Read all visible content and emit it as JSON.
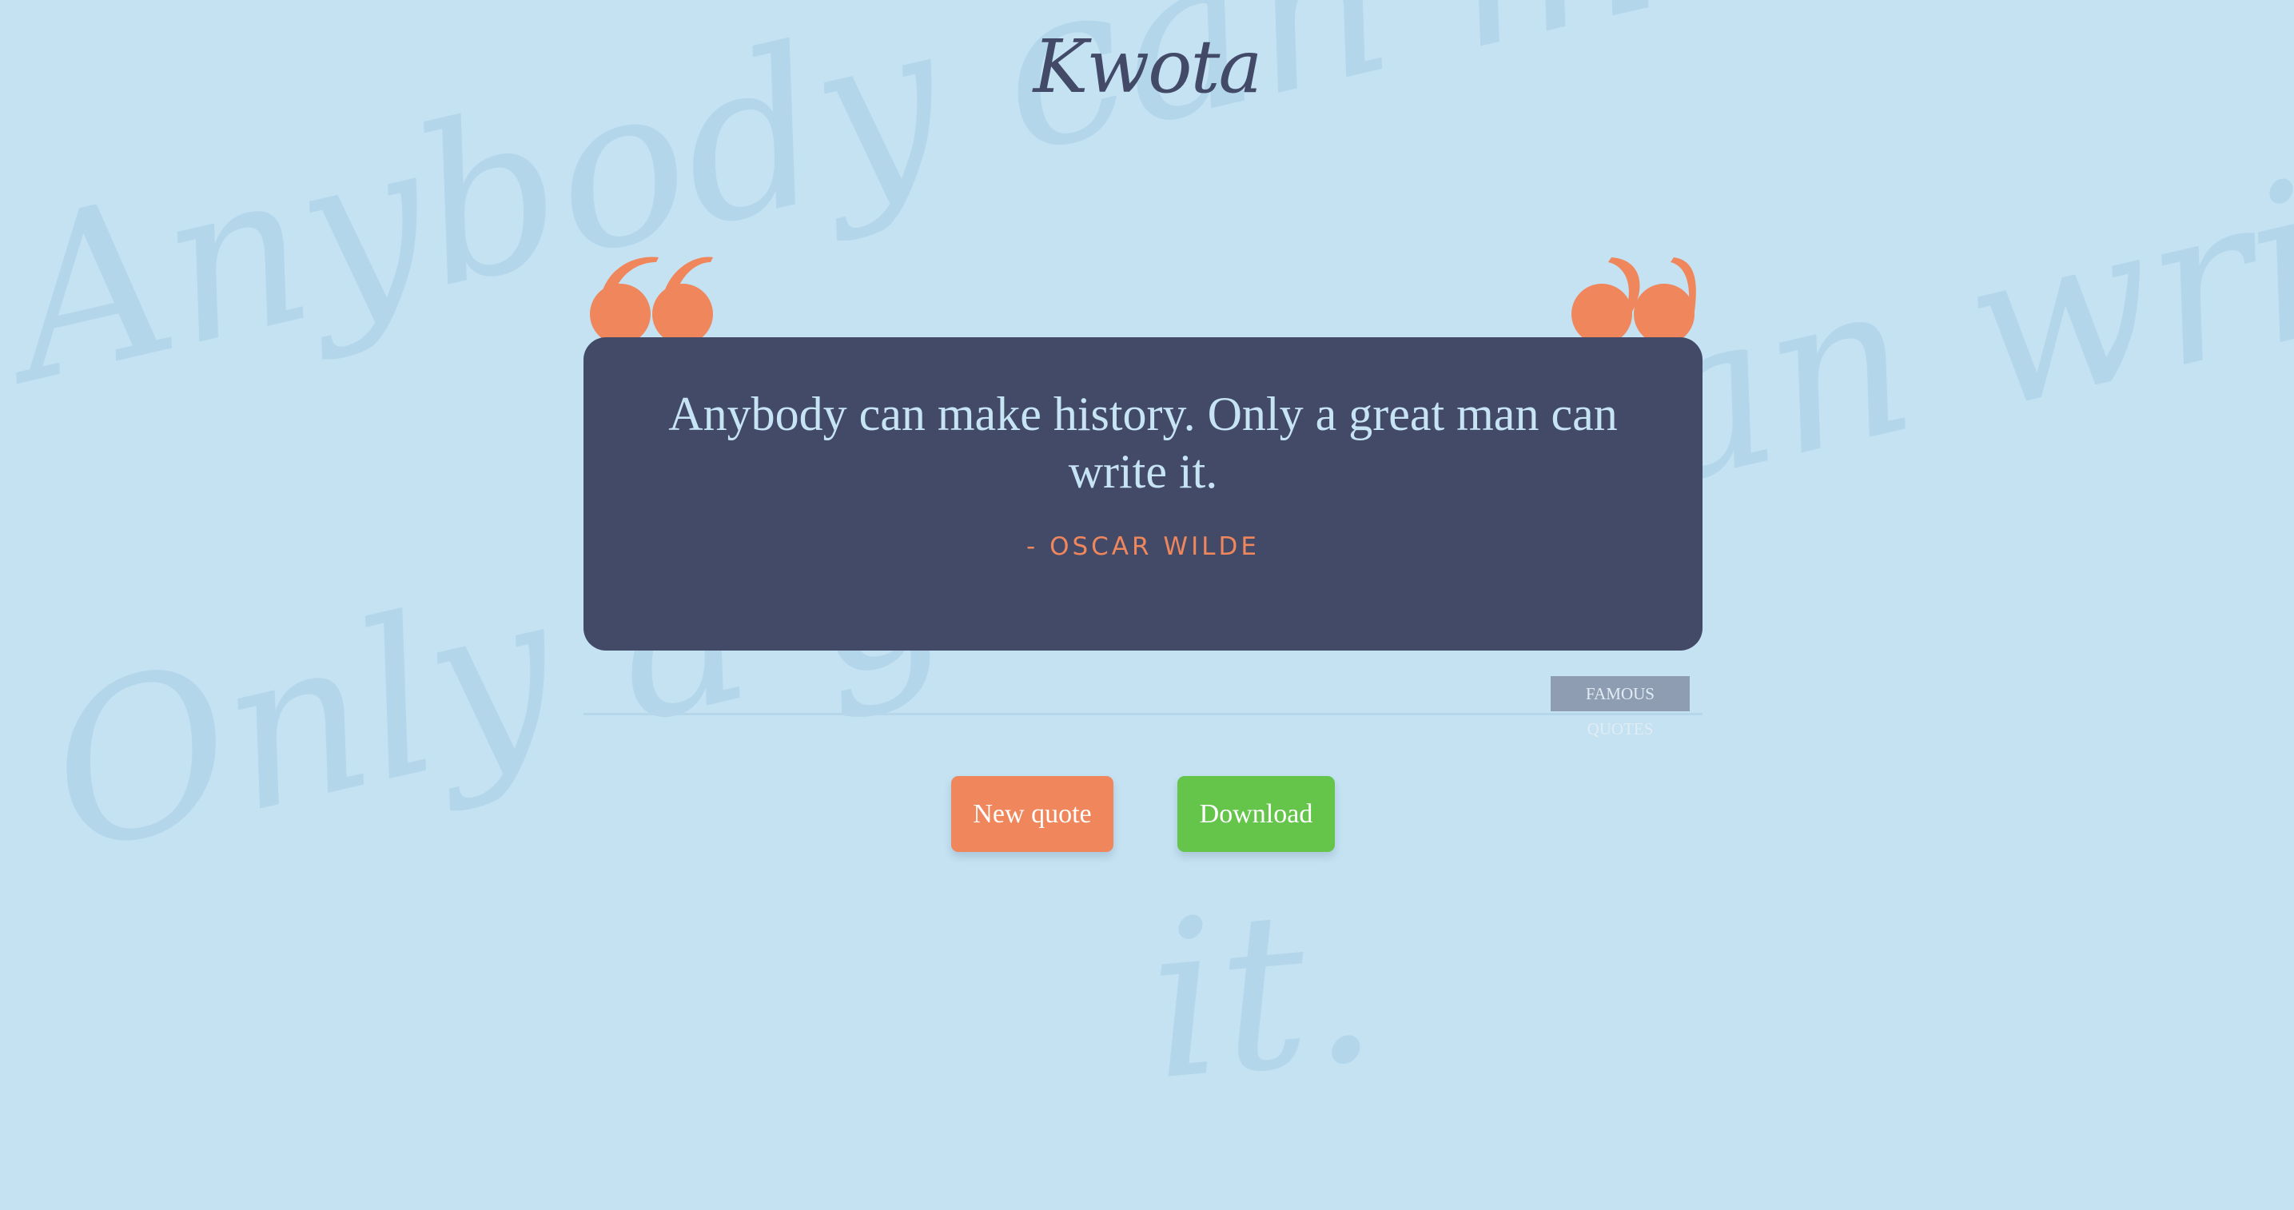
{
  "app": {
    "logo_text": "Kwota"
  },
  "background": {
    "line1": "Anybody can make history.",
    "line2": "Only a great man write",
    "line3": "it."
  },
  "quote": {
    "text": "Anybody can make history. Only a great man can write it.",
    "author": "- OSCAR WILDE",
    "tag": "FAMOUS QUOTES"
  },
  "actions": {
    "new_quote_label": "New quote",
    "download_label": "Download"
  },
  "icons": {
    "open_quote": "open-quote-icon",
    "close_quote": "close-quote-icon"
  },
  "colors": {
    "background": "#c4e2f2",
    "card": "#424a68",
    "accent": "#f0865c",
    "download": "#65c54b",
    "tag": "#8f9db2"
  }
}
